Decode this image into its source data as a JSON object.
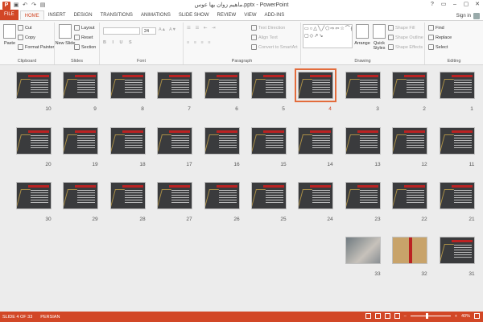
{
  "window": {
    "title": "ماهیم زوان یها عوس.pptx - PowerPoint",
    "controls": [
      "?",
      "▭",
      "–",
      "▢",
      "✕"
    ]
  },
  "qat": [
    "save-icon",
    "undo-icon",
    "redo-icon",
    "start-slideshow-icon"
  ],
  "tabs": [
    "FILE",
    "HOME",
    "INSERT",
    "DESIGN",
    "TRANSITIONS",
    "ANIMATIONS",
    "SLIDE SHOW",
    "REVIEW",
    "VIEW",
    "ADD-INS"
  ],
  "active_tab": "HOME",
  "signin": "Sign in",
  "ribbon": {
    "clipboard": {
      "paste": "Paste",
      "cut": "Cut",
      "copy": "Copy",
      "format_painter": "Format Painter",
      "label": "Clipboard"
    },
    "slides": {
      "new_slide": "New Slide",
      "layout": "Layout",
      "reset": "Reset",
      "section": "Section",
      "label": "Slides"
    },
    "font": {
      "font_name": "",
      "font_size": "24",
      "label": "Font"
    },
    "paragraph": {
      "text_direction": "Text Direction",
      "align_text": "Align Text",
      "convert_smartart": "Convert to SmartArt",
      "label": "Paragraph"
    },
    "drawing": {
      "arrange": "Arrange",
      "quick_styles": "Quick Styles",
      "shape_fill": "Shape Fill",
      "shape_outline": "Shape Outline",
      "shape_effects": "Shape Effects",
      "label": "Drawing"
    },
    "editing": {
      "find": "Find",
      "replace": "Replace",
      "select": "Select",
      "label": "Editing"
    }
  },
  "slides": {
    "selected": 4,
    "rows": [
      [
        10,
        9,
        8,
        7,
        6,
        5,
        4,
        3,
        2,
        1
      ],
      [
        20,
        19,
        18,
        17,
        16,
        15,
        14,
        13,
        12,
        11
      ],
      [
        30,
        29,
        28,
        27,
        26,
        25,
        24,
        23,
        22,
        21
      ],
      [
        33,
        32,
        31
      ]
    ]
  },
  "status": {
    "slide_info": "SLIDE 4 OF 33",
    "language": "PERSIAN",
    "zoom": "40%",
    "zoom_fraction": 0.4
  },
  "colors": {
    "accent": "#d24726",
    "selection": "#e36c3c",
    "slide_bg": "#3a3b3d"
  }
}
